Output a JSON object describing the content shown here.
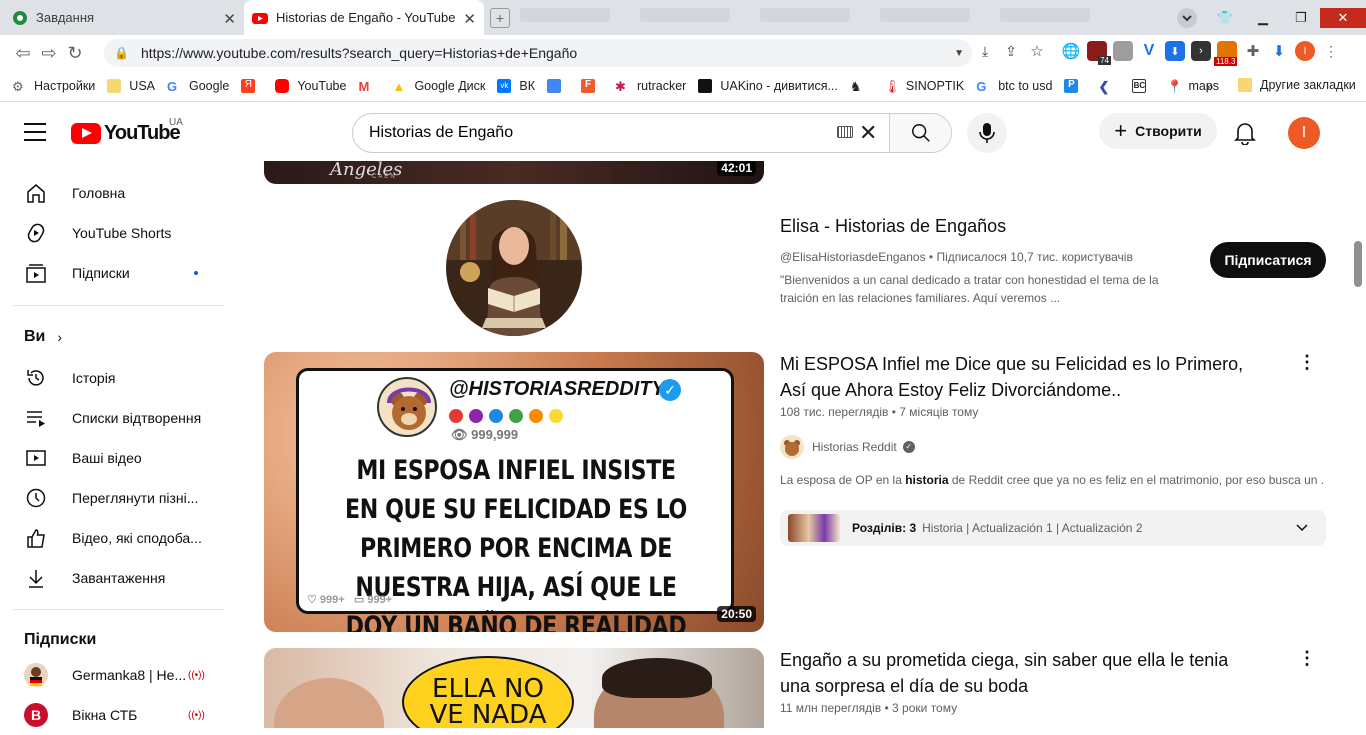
{
  "browser": {
    "tabs": [
      {
        "title": "Завдання"
      },
      {
        "title": "Historias de Engaño - YouTube"
      }
    ],
    "url": "https://www.youtube.com/results?search_query=Historias+de+Engaño",
    "extensions": {
      "badge_74": "74",
      "badge_118": "118.3",
      "profile_letter": "I"
    },
    "bookmarks": [
      {
        "label": "Настройки"
      },
      {
        "label": "USA"
      },
      {
        "label": "Google"
      },
      {
        "label": ""
      },
      {
        "label": "YouTube"
      },
      {
        "label": ""
      },
      {
        "label": "Google Диск"
      },
      {
        "label": "ВК"
      },
      {
        "label": ""
      },
      {
        "label": ""
      },
      {
        "label": "rutracker"
      },
      {
        "label": "UAKino - дивитися..."
      },
      {
        "label": ""
      },
      {
        "label": "SINOPTIK"
      },
      {
        "label": "btc to usd"
      },
      {
        "label": ""
      },
      {
        "label": ""
      },
      {
        "label": ""
      },
      {
        "label": "maps"
      }
    ],
    "bookmarks_more": "»",
    "other_bookmarks": "Другие закладки"
  },
  "header": {
    "logo_text": "YouTube",
    "region": "UA",
    "search_value": "Historias de Engaño",
    "create_label": "Створити",
    "avatar_letter": "I"
  },
  "sidebar": {
    "main": [
      {
        "label": "Головна"
      },
      {
        "label": "YouTube Shorts"
      },
      {
        "label": "Підписки"
      }
    ],
    "you_heading": "Ви",
    "you": [
      {
        "label": "Історія"
      },
      {
        "label": "Списки відтворення"
      },
      {
        "label": "Ваші відео"
      },
      {
        "label": "Переглянути пізні..."
      },
      {
        "label": "Відео, які сподоба..."
      },
      {
        "label": "Завантаження"
      }
    ],
    "subs_heading": "Підписки",
    "subs": [
      {
        "label": "Germanka8 | Не..."
      },
      {
        "label": "Вікна СТБ"
      }
    ]
  },
  "results": {
    "first_video": {
      "duration": "42:01",
      "thumb_text": "Ángeles",
      "thumb_subtext": "CAEN"
    },
    "channel": {
      "name": "Elisa - Historias de Engaños",
      "handle_line": "@ElisaHistoriasdeEnganos • Підписалося 10,7 тис. користувачів",
      "description": "\"Bienvenidos a un canal dedicado a tratar con honestidad el tema de la traición en las relaciones familiares. Aquí veremos ...",
      "subscribe_label": "Підписатися"
    },
    "video2": {
      "title": "Mi ESPOSA Infiel me Dice que su Felicidad es lo Primero, Así que Ahora Estoy Feliz Divorciándome..",
      "meta": "108 тис. переглядів • 7 місяців тому",
      "channel": "Historias Reddit",
      "desc_pre": "La esposa de OP en la ",
      "desc_bold": "historia",
      "desc_post": " de Reddit cree que ya no es feliz en el matrimonio, por eso busca un ...",
      "chapters_label": "Розділів: 3",
      "chapters_list": "Historia | Actualización 1 | Actualización 2",
      "duration": "20:50",
      "thumb_handle": "@HISTORIASREDDITYA",
      "thumb_views": "999,999",
      "thumb_text": "MI ESPOSA INFIEL INSISTE EN QUE SU FELICIDAD ES LO PRIMERO POR ENCIMA DE NUESTRA HIJA, ASÍ QUE LE DOY UN BAÑO DE REALIDAD AL DIVORCIARME.",
      "thumb_likes": "999+",
      "thumb_comments": "999+"
    },
    "video3": {
      "title": "Engaño a su prometida ciega, sin saber que ella le tenia una sorpresa el día de su boda",
      "meta": "11 млн переглядів • 3 роки тому",
      "thumb_bubble": "ELLA NO VE NADA"
    }
  }
}
